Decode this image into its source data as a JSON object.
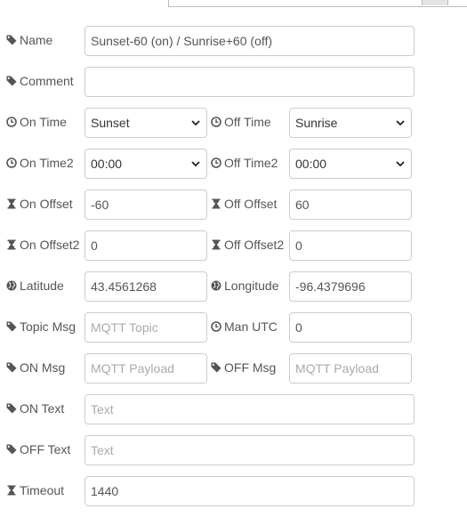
{
  "rows": {
    "name": {
      "label": "Name",
      "icon": "tag-icon",
      "value": "Sunset-60 (on) / Sunrise+60 (off)"
    },
    "comment": {
      "label": "Comment",
      "icon": "tag-icon",
      "value": ""
    },
    "on_time": {
      "label": "On Time",
      "icon": "clock-icon",
      "value": "Sunset"
    },
    "off_time": {
      "label": "Off Time",
      "icon": "clock-icon",
      "value": "Sunrise"
    },
    "on_time2": {
      "label": "On Time2",
      "icon": "clock-icon",
      "value": "00:00"
    },
    "off_time2": {
      "label": "Off Time2",
      "icon": "clock-icon",
      "value": "00:00"
    },
    "on_offset": {
      "label": "On Offset",
      "icon": "hourglass-icon",
      "value": "-60"
    },
    "off_offset": {
      "label": "Off Offset",
      "icon": "hourglass-icon",
      "value": "60"
    },
    "on_offset2": {
      "label": "On Offset2",
      "icon": "hourglass-icon",
      "value": "0"
    },
    "off_offset2": {
      "label": "Off Offset2",
      "icon": "hourglass-icon",
      "value": "0"
    },
    "latitude": {
      "label": "Latitude",
      "icon": "globe-icon",
      "value": "43.4561268"
    },
    "longitude": {
      "label": "Longitude",
      "icon": "globe-icon",
      "value": "-96.4379696"
    },
    "topic_msg": {
      "label": "Topic Msg",
      "icon": "tag-icon",
      "value": "",
      "placeholder": "MQTT Topic"
    },
    "man_utc": {
      "label": "Man UTC",
      "icon": "clock-icon",
      "value": "0"
    },
    "on_msg": {
      "label": "ON Msg",
      "icon": "tag-icon",
      "value": "",
      "placeholder": "MQTT Payload"
    },
    "off_msg": {
      "label": "OFF Msg",
      "icon": "tag-icon",
      "value": "",
      "placeholder": "MQTT Payload"
    },
    "on_text": {
      "label": "ON Text",
      "icon": "tag-icon",
      "value": "",
      "placeholder": "Text"
    },
    "off_text": {
      "label": "OFF Text",
      "icon": "tag-icon",
      "value": "",
      "placeholder": "Text"
    },
    "timeout": {
      "label": "Timeout",
      "icon": "hourglass-icon",
      "value": "1440"
    }
  },
  "colors": {
    "label_text": "#555555",
    "input_border": "#cccccc",
    "placeholder": "#aaaaaa",
    "icon": "#555555"
  }
}
